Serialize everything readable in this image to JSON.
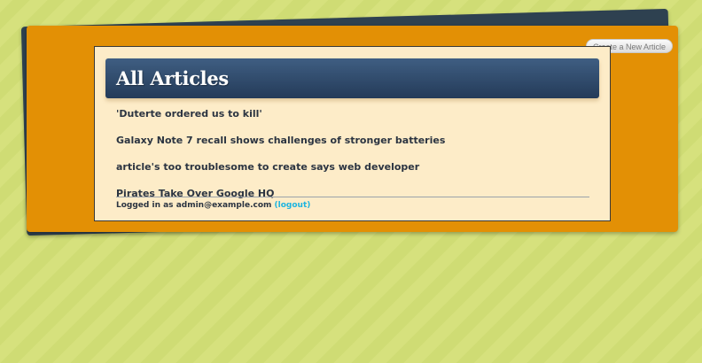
{
  "header": {
    "title": "All Articles"
  },
  "toolbar": {
    "new_article_label": "Create a New Article"
  },
  "articles": [
    {
      "title": "'Duterte ordered us to kill'"
    },
    {
      "title": "Galaxy Note 7 recall shows challenges of stronger batteries"
    },
    {
      "title": "article's too troublesome to create says web developer"
    },
    {
      "title": "Pirates Take Over Google HQ"
    }
  ],
  "footer": {
    "logged_in_prefix": "Logged in as",
    "user_email": "admin@example.com",
    "logout_label": "(logout)"
  },
  "colors": {
    "background": "#d6e17d",
    "sheet": "#e39005",
    "back_sheet": "#2e4150",
    "panel": "#fdecc8",
    "header": "#2f4b6c",
    "link_accent": "#1eb4df"
  }
}
